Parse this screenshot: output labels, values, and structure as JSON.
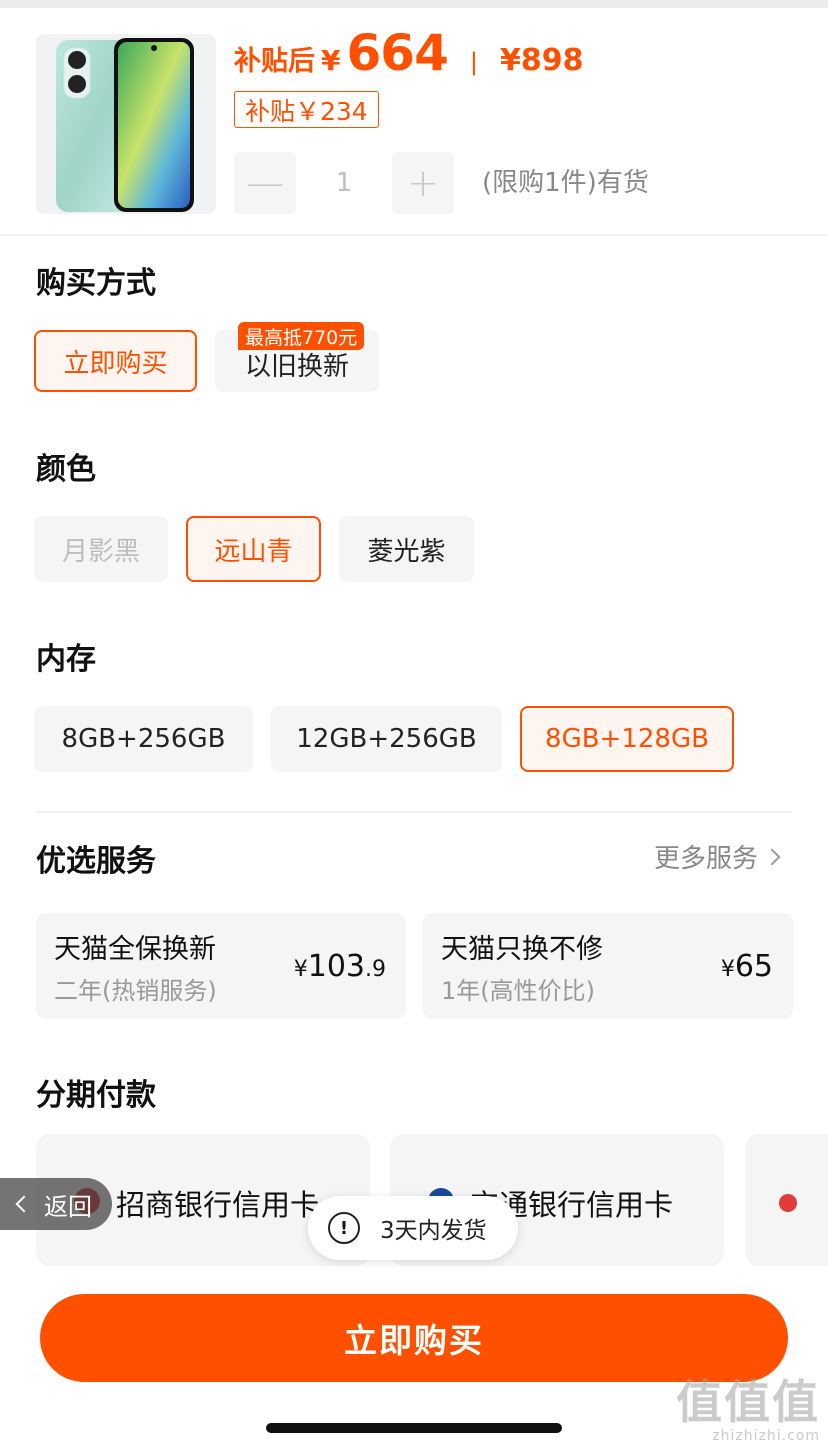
{
  "product": {
    "price_label": "补贴后",
    "currency": "¥",
    "price": "664",
    "separator": "|",
    "original_price": "¥898",
    "subsidy": "补贴￥234",
    "quantity": "1",
    "minus": "—",
    "plus": "+",
    "stock": "(限购1件)有货"
  },
  "purchase_method": {
    "title": "购买方式",
    "options": [
      "立即购买",
      "以旧换新"
    ],
    "selected": "立即购买",
    "badge": "最高抵770元"
  },
  "color": {
    "title": "颜色",
    "options": [
      "月影黑",
      "远山青",
      "菱光紫"
    ],
    "selected": "远山青",
    "disabled": [
      "月影黑"
    ]
  },
  "memory": {
    "title": "内存",
    "options": [
      "8GB+256GB",
      "12GB+256GB",
      "8GB+128GB"
    ],
    "selected": "8GB+128GB"
  },
  "services": {
    "title": "优选服务",
    "more": "更多服务",
    "items": [
      {
        "name": "天猫全保换新",
        "desc": "二年(热销服务)",
        "currency": "¥",
        "price": "103",
        "decimal": ".9"
      },
      {
        "name": "天猫只换不修",
        "desc": "1年(高性价比)",
        "currency": "¥",
        "price": "65",
        "decimal": ""
      }
    ]
  },
  "installment": {
    "title": "分期付款",
    "cards": [
      "招商银行信用卡",
      "交通银行信用卡"
    ]
  },
  "overlay": {
    "back": "返回",
    "shipping": "3天内发货",
    "warn_icon": "!"
  },
  "buy_button": "立即购买",
  "watermark": {
    "big": "值值值",
    "small": "zhizhizhi.com"
  },
  "colors": {
    "accent": "#ff5000",
    "chip_bg": "#f5f5f5",
    "selected_bg": "#fff5f0"
  }
}
